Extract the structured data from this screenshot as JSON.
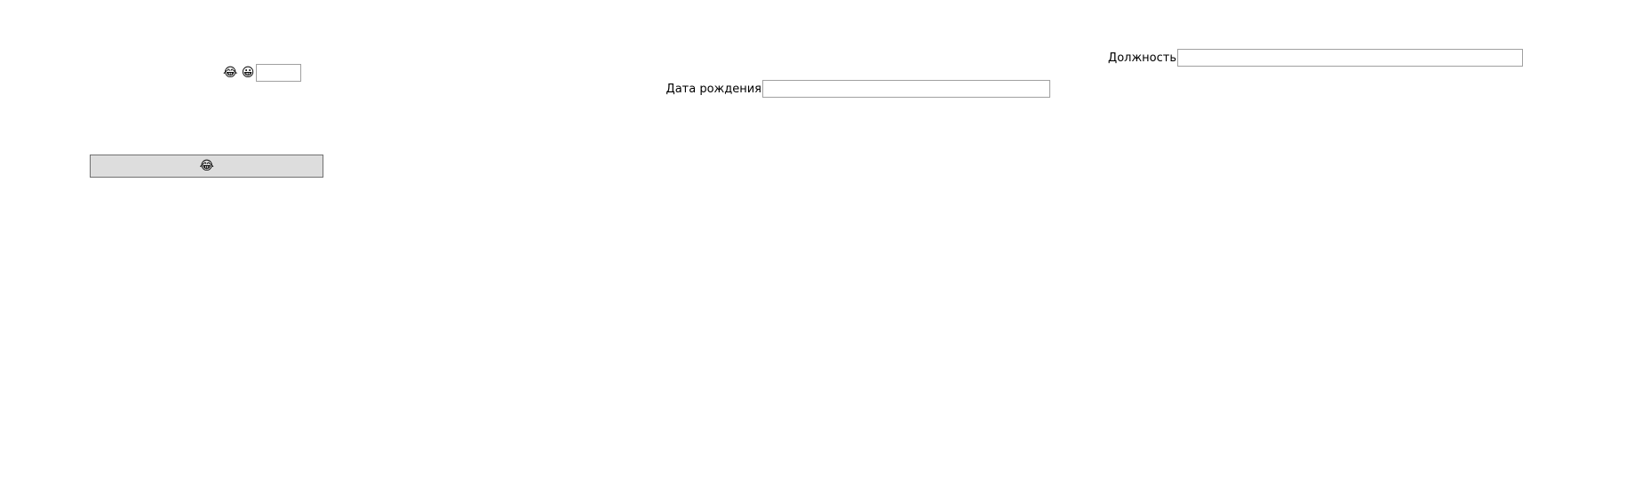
{
  "toolbar": {
    "emoji_1": "😂",
    "emoji_2": "😀",
    "small_input_value": ""
  },
  "action_button": {
    "label": "😂"
  },
  "form": {
    "birth_date": {
      "label": "Дата рождения",
      "value": ""
    },
    "position": {
      "label": "Должность",
      "value": ""
    }
  }
}
